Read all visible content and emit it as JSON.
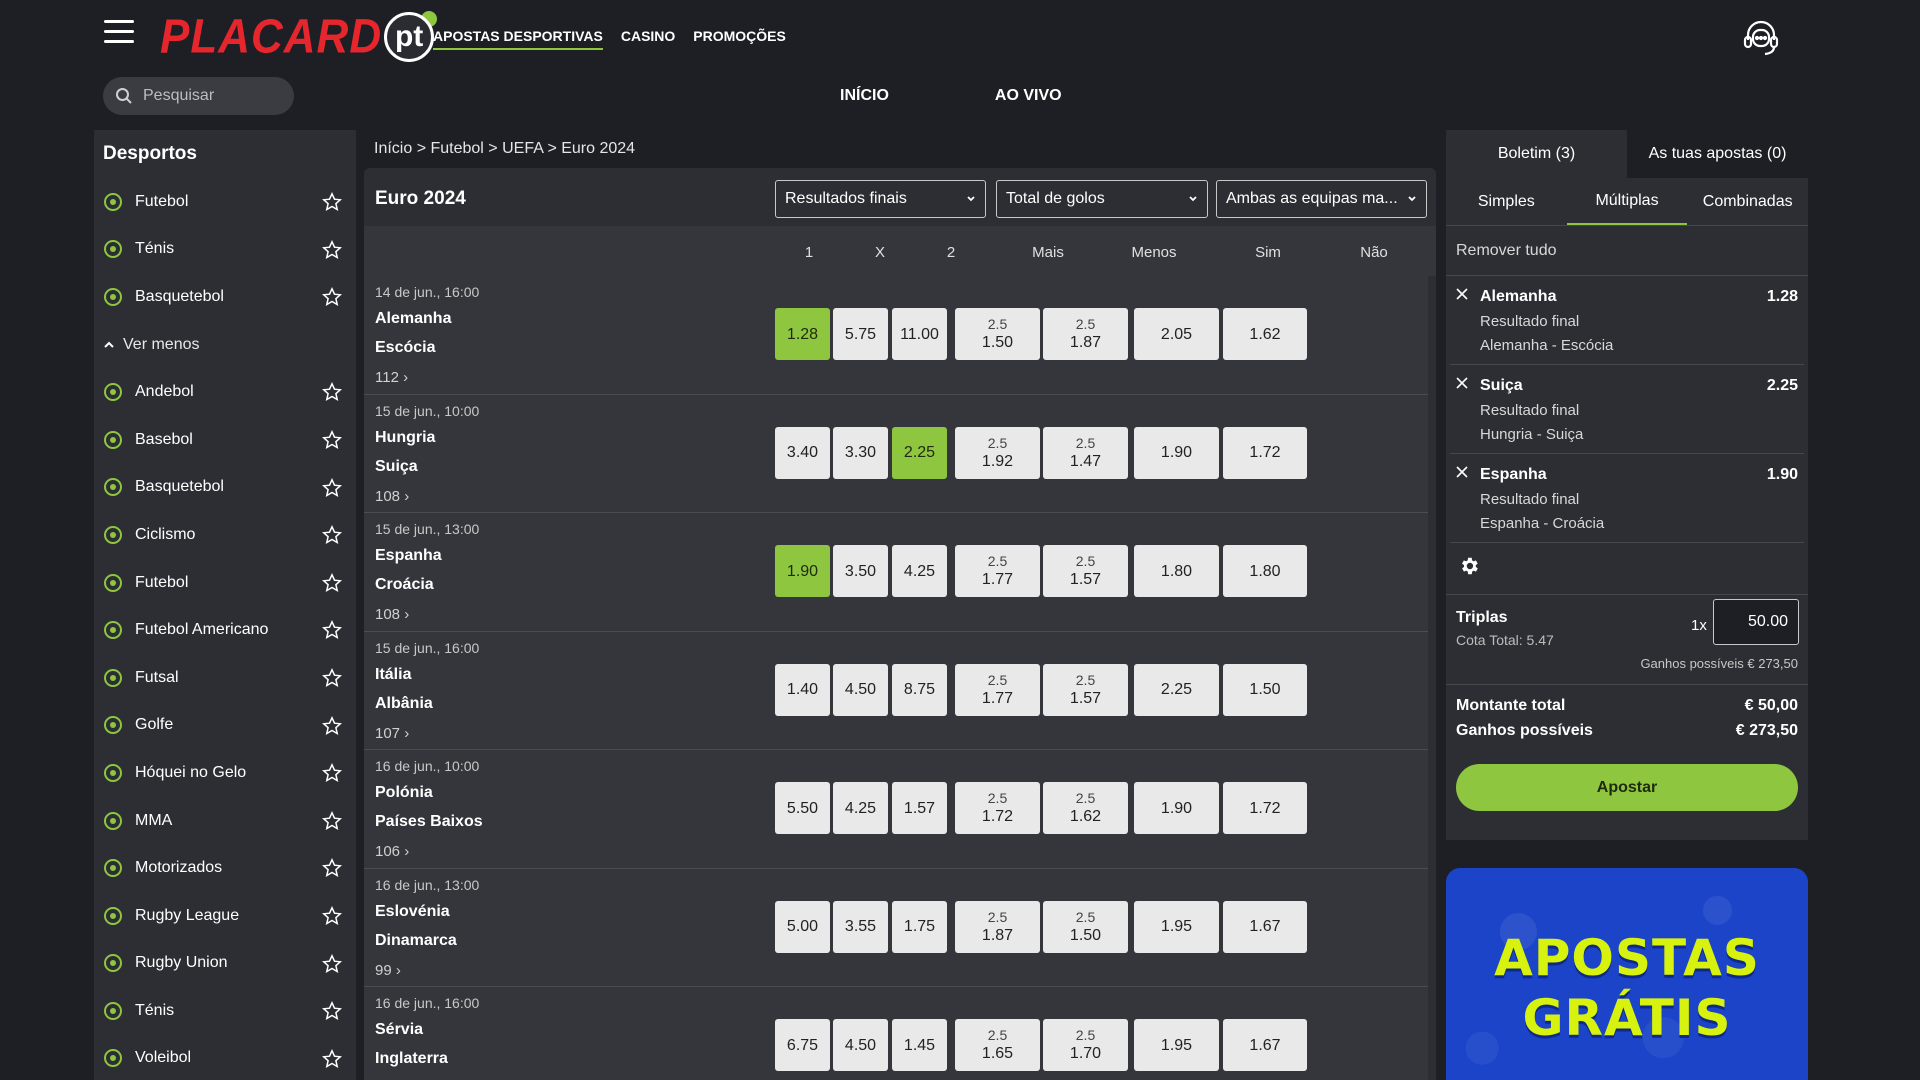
{
  "header": {
    "logo_text": "PLACARD",
    "logo_suffix": "pt",
    "nav": [
      {
        "label": "APOSTAS DESPORTIVAS",
        "active": true
      },
      {
        "label": "CASINO",
        "active": false
      },
      {
        "label": "PROMOÇÕES",
        "active": false
      }
    ],
    "search_placeholder": "Pesquisar",
    "subnav": [
      "INÍCIO",
      "AO VIVO"
    ]
  },
  "sidebar": {
    "title": "Desportos",
    "top_items": [
      {
        "label": "Futebol",
        "icon": "soccer-icon"
      },
      {
        "label": "Ténis",
        "icon": "tennis-icon"
      },
      {
        "label": "Basquetebol",
        "icon": "basketball-icon"
      }
    ],
    "toggle_label": "Ver menos",
    "items": [
      {
        "label": "Andebol",
        "icon": "handball-icon"
      },
      {
        "label": "Basebol",
        "icon": "baseball-icon"
      },
      {
        "label": "Basquetebol",
        "icon": "basketball-icon"
      },
      {
        "label": "Ciclismo",
        "icon": "cycling-icon"
      },
      {
        "label": "Futebol",
        "icon": "soccer-icon"
      },
      {
        "label": "Futebol Americano",
        "icon": "american-football-icon"
      },
      {
        "label": "Futsal",
        "icon": "futsal-icon"
      },
      {
        "label": "Golfe",
        "icon": "golf-icon"
      },
      {
        "label": "Hóquei no Gelo",
        "icon": "ice-hockey-icon"
      },
      {
        "label": "MMA",
        "icon": "mma-icon"
      },
      {
        "label": "Motorizados",
        "icon": "motorsport-icon"
      },
      {
        "label": "Rugby League",
        "icon": "rugby-icon"
      },
      {
        "label": "Rugby Union",
        "icon": "rugby-icon"
      },
      {
        "label": "Ténis",
        "icon": "tennis-icon"
      },
      {
        "label": "Voleibol",
        "icon": "volleyball-icon"
      }
    ]
  },
  "breadcrumb": [
    "Início",
    "Futebol",
    "UEFA",
    "Euro 2024"
  ],
  "competition": {
    "title": "Euro 2024",
    "selects": [
      "Resultados finais",
      "Total de golos",
      "Ambas as equipas ma..."
    ],
    "columns": [
      "1",
      "X",
      "2",
      "Mais",
      "Menos",
      "Sim",
      "Não"
    ]
  },
  "matches": [
    {
      "date": "14 de jun., 16:00",
      "home": "Alemanha",
      "away": "Escócia",
      "more": "112",
      "o1": "1.28",
      "ox": "5.75",
      "o2": "11.00",
      "line_over": "2.5",
      "over": "1.50",
      "line_under": "2.5",
      "under": "1.87",
      "sim": "2.05",
      "nao": "1.62",
      "selected": "1"
    },
    {
      "date": "15 de jun., 10:00",
      "home": "Hungria",
      "away": "Suiça",
      "more": "108",
      "o1": "3.40",
      "ox": "3.30",
      "o2": "2.25",
      "line_over": "2.5",
      "over": "1.92",
      "line_under": "2.5",
      "under": "1.47",
      "sim": "1.90",
      "nao": "1.72",
      "selected": "2"
    },
    {
      "date": "15 de jun., 13:00",
      "home": "Espanha",
      "away": "Croácia",
      "more": "108",
      "o1": "1.90",
      "ox": "3.50",
      "o2": "4.25",
      "line_over": "2.5",
      "over": "1.77",
      "line_under": "2.5",
      "under": "1.57",
      "sim": "1.80",
      "nao": "1.80",
      "selected": "1"
    },
    {
      "date": "15 de jun., 16:00",
      "home": "Itália",
      "away": "Albânia",
      "more": "107",
      "o1": "1.40",
      "ox": "4.50",
      "o2": "8.75",
      "line_over": "2.5",
      "over": "1.77",
      "line_under": "2.5",
      "under": "1.57",
      "sim": "2.25",
      "nao": "1.50",
      "selected": ""
    },
    {
      "date": "16 de jun., 10:00",
      "home": "Polónia",
      "away": "Países Baixos",
      "more": "106",
      "o1": "5.50",
      "ox": "4.25",
      "o2": "1.57",
      "line_over": "2.5",
      "over": "1.72",
      "line_under": "2.5",
      "under": "1.62",
      "sim": "1.90",
      "nao": "1.72",
      "selected": ""
    },
    {
      "date": "16 de jun., 13:00",
      "home": "Eslovénia",
      "away": "Dinamarca",
      "more": "99",
      "o1": "5.00",
      "ox": "3.55",
      "o2": "1.75",
      "line_over": "2.5",
      "over": "1.87",
      "line_under": "2.5",
      "under": "1.50",
      "sim": "1.95",
      "nao": "1.67",
      "selected": ""
    },
    {
      "date": "16 de jun., 16:00",
      "home": "Sérvia",
      "away": "Inglaterra",
      "more": "",
      "o1": "6.75",
      "ox": "4.50",
      "o2": "1.45",
      "line_over": "2.5",
      "over": "1.65",
      "line_under": "2.5",
      "under": "1.70",
      "sim": "1.95",
      "nao": "1.67",
      "selected": ""
    }
  ],
  "betslip": {
    "tabs": [
      "Boletim (3)",
      "As tuas apostas (0)"
    ],
    "modes": [
      "Simples",
      "Múltiplas",
      "Combinadas"
    ],
    "active_mode": "Múltiplas",
    "remove_all": "Remover tudo",
    "bets": [
      {
        "selection": "Alemanha",
        "odd": "1.28",
        "market": "Resultado final",
        "event": "Alemanha - Escócia"
      },
      {
        "selection": "Suiça",
        "odd": "2.25",
        "market": "Resultado final",
        "event": "Hungria - Suiça"
      },
      {
        "selection": "Espanha",
        "odd": "1.90",
        "market": "Resultado final",
        "event": "Espanha - Croácia"
      }
    ],
    "combo_label": "Triplas",
    "cota_total": "Cota Total: 5.47",
    "multiplier": "1x",
    "stake": "50.00",
    "combo_winnings": "Ganhos possíveis € 273,50",
    "total_label": "Montante total",
    "total_value": "€ 50,00",
    "winnings_label": "Ganhos possíveis",
    "winnings_value": "€ 273,50",
    "button": "Apostar"
  },
  "promo": {
    "line1": "APOSTAS",
    "line2": "GRÁTIS"
  },
  "colors": {
    "accent": "#8ec63f",
    "logo_red": "#e6262d",
    "promo_blue": "#1b44c8",
    "promo_text": "#d8f20f"
  }
}
